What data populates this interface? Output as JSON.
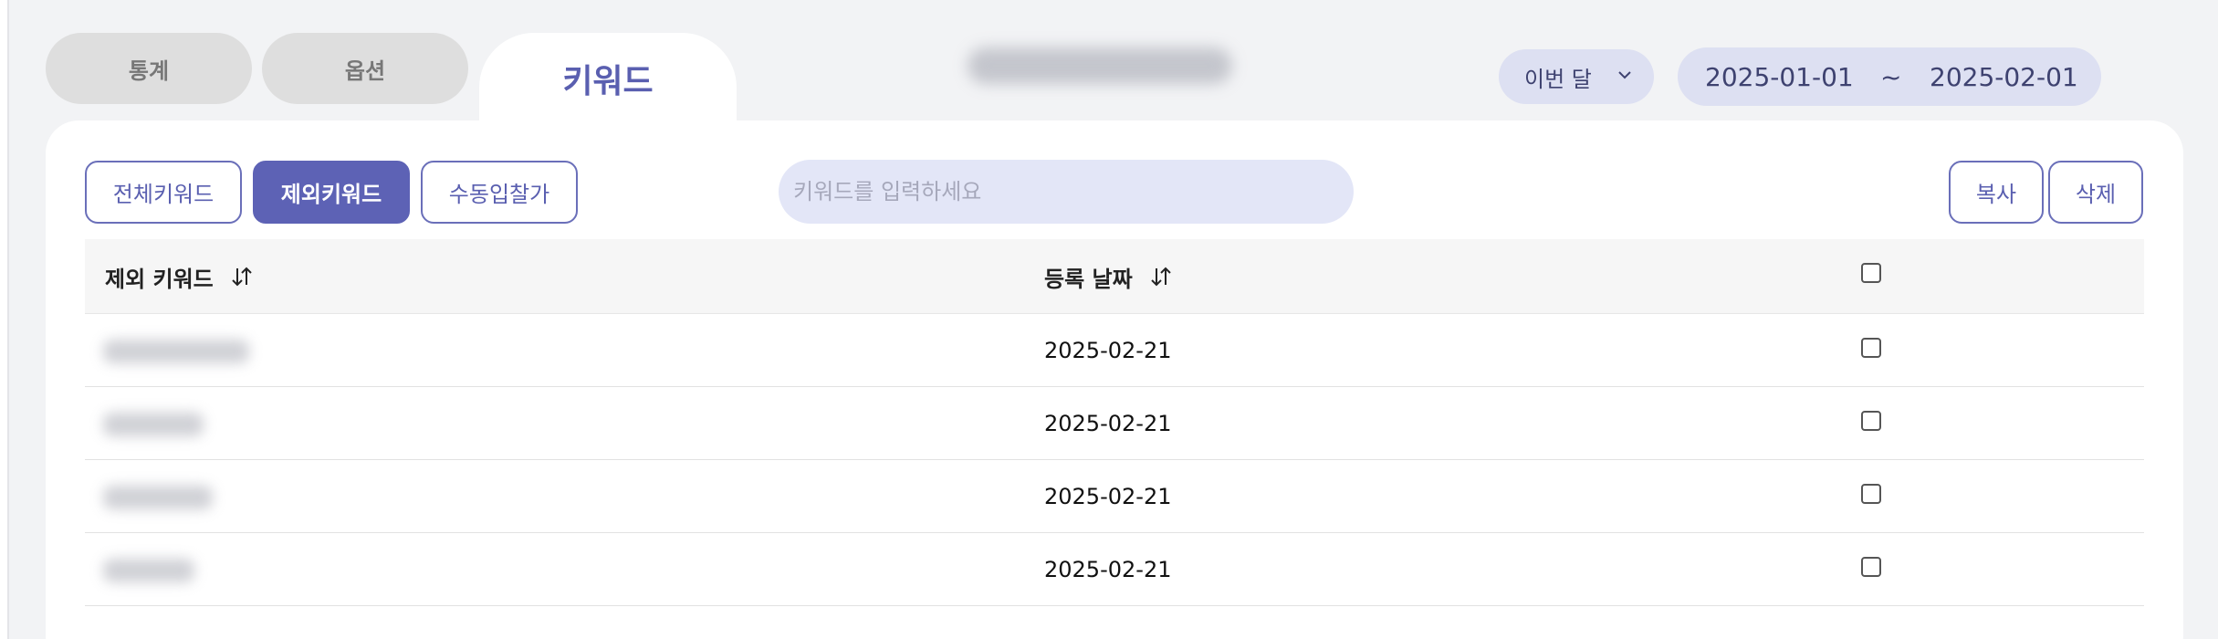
{
  "tabs": {
    "stats": "통계",
    "options": "옵션",
    "keyword": "키워드"
  },
  "period": {
    "selected": "이번 달",
    "start_date": "2025-01-01",
    "separator": "~",
    "end_date": "2025-02-01"
  },
  "filters": {
    "all": "전체키워드",
    "excluded": "제외키워드",
    "manual": "수동입찰가",
    "active": "제외키워드"
  },
  "search": {
    "placeholder": "키워드를 입력하세요",
    "value": ""
  },
  "actions": {
    "copy": "복사",
    "delete": "삭제"
  },
  "table": {
    "columns": [
      "제외 키워드",
      "등록 날짜"
    ],
    "rows": [
      {
        "keyword": "",
        "date": "2025-02-21",
        "checked": false
      },
      {
        "keyword": "",
        "date": "2025-02-21",
        "checked": false
      },
      {
        "keyword": "",
        "date": "2025-02-21",
        "checked": false
      },
      {
        "keyword": "",
        "date": "2025-02-21",
        "checked": false
      }
    ]
  },
  "colors": {
    "accent": "#5d62b5",
    "accent_light": "#dde0f2",
    "background": "#f2f3f5",
    "card": "#ffffff"
  },
  "icons": {
    "sort": "sort-arrows-icon",
    "dropdown": "chevron-down-icon",
    "checkbox": "checkbox-icon"
  }
}
